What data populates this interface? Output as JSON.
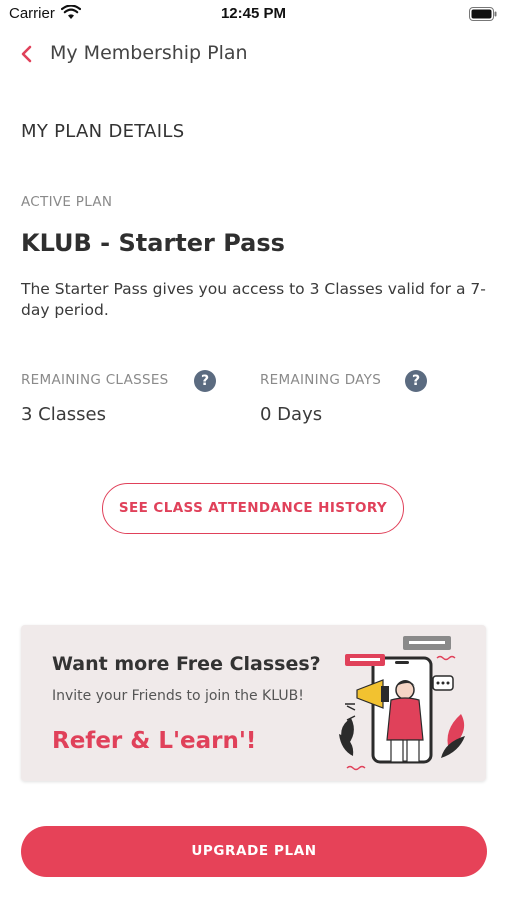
{
  "status_bar": {
    "carrier": "Carrier",
    "time": "12:45 PM"
  },
  "nav": {
    "title": "My Membership Plan"
  },
  "section_title": "MY PLAN DETAILS",
  "plan": {
    "active_label": "ACTIVE PLAN",
    "name": "KLUB - Starter Pass",
    "description": "The Starter Pass gives you access to 3 Classes valid for a 7-day period."
  },
  "stats": {
    "remaining_classes_label": "REMAINING CLASSES",
    "remaining_classes_value": "3 Classes",
    "remaining_days_label": "REMAINING DAYS",
    "remaining_days_value": "0 Days",
    "help_glyph": "?"
  },
  "history_button": "SEE CLASS ATTENDANCE HISTORY",
  "refer": {
    "title": "Want more Free Classes?",
    "subtitle": "Invite your Friends to join the KLUB!",
    "cta": "Refer & L'earn'!"
  },
  "upgrade_button": "UPGRADE PLAN",
  "colors": {
    "accent": "#e0415a",
    "button_fill": "#e64258",
    "help_icon": "#5b6b80",
    "card_bg": "#f0eaea"
  }
}
